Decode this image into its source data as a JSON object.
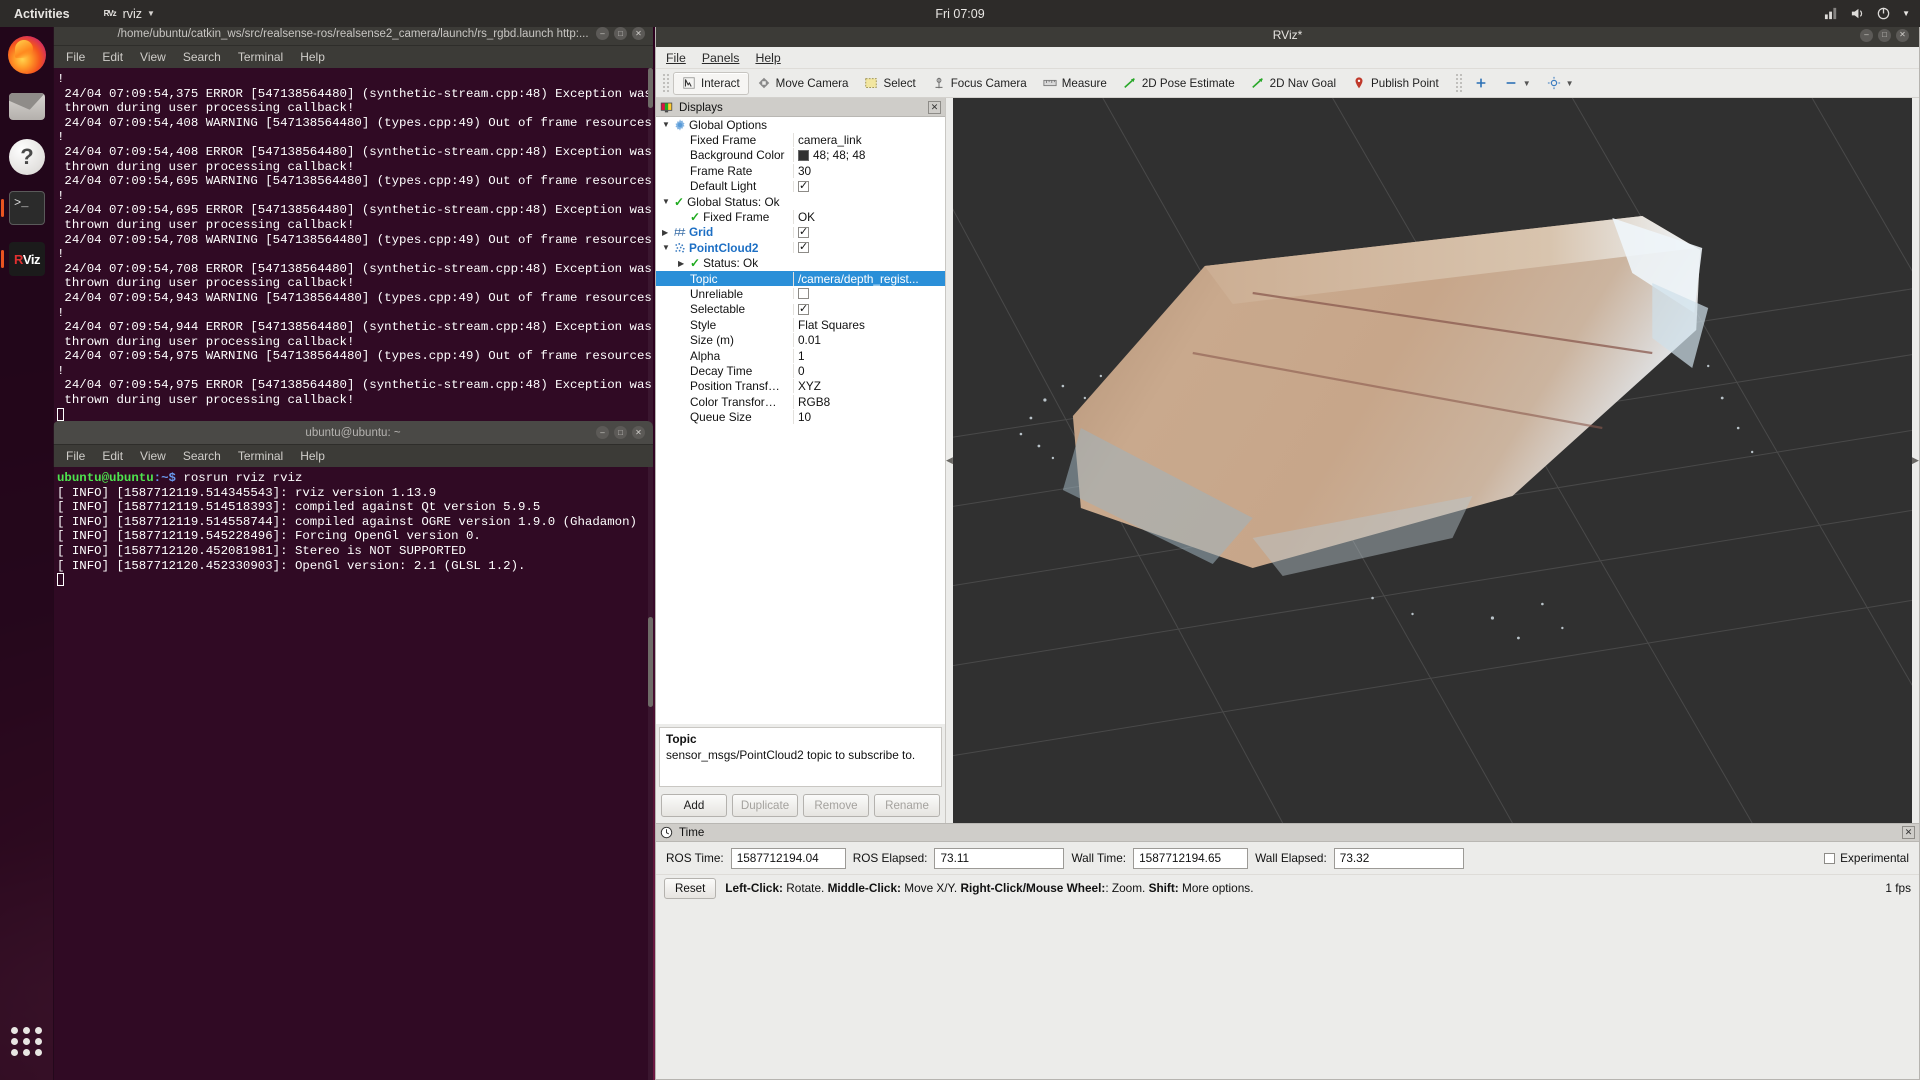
{
  "top_panel": {
    "activities": "Activities",
    "app_name": "rviz",
    "app_logo": "RViz",
    "clock": "Fri 07:09",
    "icons": [
      "network-icon",
      "volume-icon",
      "power-icon",
      "chevron-down-icon"
    ]
  },
  "dock": {
    "items": [
      {
        "name": "firefox-icon",
        "label": "Firefox"
      },
      {
        "name": "thunderbird-icon",
        "label": "Thunderbird"
      },
      {
        "name": "help-icon",
        "label": "Help"
      },
      {
        "name": "terminal-icon",
        "label": "Terminal"
      },
      {
        "name": "rviz-icon",
        "label": "RViz"
      }
    ],
    "show_apps": "show-applications-icon"
  },
  "terminal1": {
    "title": "/home/ubuntu/catkin_ws/src/realsense-ros/realsense2_camera/launch/rs_rgbd.launch http:...",
    "menu": [
      "File",
      "Edit",
      "View",
      "Search",
      "Terminal",
      "Help"
    ],
    "lines": [
      "!",
      " 24/04 07:09:54,375 ERROR [547138564480] (synthetic-stream.cpp:48) Exception was",
      " thrown during user processing callback!",
      " 24/04 07:09:54,408 WARNING [547138564480] (types.cpp:49) Out of frame resources",
      "!",
      " 24/04 07:09:54,408 ERROR [547138564480] (synthetic-stream.cpp:48) Exception was",
      " thrown during user processing callback!",
      " 24/04 07:09:54,695 WARNING [547138564480] (types.cpp:49) Out of frame resources",
      "!",
      " 24/04 07:09:54,695 ERROR [547138564480] (synthetic-stream.cpp:48) Exception was",
      " thrown during user processing callback!",
      " 24/04 07:09:54,708 WARNING [547138564480] (types.cpp:49) Out of frame resources",
      "!",
      " 24/04 07:09:54,708 ERROR [547138564480] (synthetic-stream.cpp:48) Exception was",
      " thrown during user processing callback!",
      " 24/04 07:09:54,943 WARNING [547138564480] (types.cpp:49) Out of frame resources",
      "!",
      " 24/04 07:09:54,944 ERROR [547138564480] (synthetic-stream.cpp:48) Exception was",
      " thrown during user processing callback!",
      " 24/04 07:09:54,975 WARNING [547138564480] (types.cpp:49) Out of frame resources",
      "!",
      " 24/04 07:09:54,975 ERROR [547138564480] (synthetic-stream.cpp:48) Exception was",
      " thrown during user processing callback!"
    ]
  },
  "terminal2": {
    "title": "ubuntu@ubuntu: ~",
    "menu": [
      "File",
      "Edit",
      "View",
      "Search",
      "Terminal",
      "Help"
    ],
    "prompt_user": "ubuntu@ubuntu",
    "prompt_path": ":~$",
    "command": " rosrun rviz rviz",
    "lines": [
      "[ INFO] [1587712119.514345543]: rviz version 1.13.9",
      "[ INFO] [1587712119.514518393]: compiled against Qt version 5.9.5",
      "[ INFO] [1587712119.514558744]: compiled against OGRE version 1.9.0 (Ghadamon)",
      "[ INFO] [1587712119.545228496]: Forcing OpenGl version 0.",
      "[ INFO] [1587712120.452081981]: Stereo is NOT SUPPORTED",
      "[ INFO] [1587712120.452330903]: OpenGl version: 2.1 (GLSL 1.2)."
    ]
  },
  "rviz": {
    "title": "RViz*",
    "menu": [
      "File",
      "Panels",
      "Help"
    ],
    "toolbar": [
      {
        "label": "Interact",
        "icon": "interact-icon",
        "selected": true
      },
      {
        "label": "Move Camera",
        "icon": "move-camera-icon",
        "selected": false
      },
      {
        "label": "Select",
        "icon": "select-icon",
        "selected": false
      },
      {
        "label": "Focus Camera",
        "icon": "focus-camera-icon",
        "selected": false
      },
      {
        "label": "Measure",
        "icon": "measure-icon",
        "selected": false
      },
      {
        "label": "2D Pose Estimate",
        "icon": "pose-estimate-icon",
        "selected": false
      },
      {
        "label": "2D Nav Goal",
        "icon": "nav-goal-icon",
        "selected": false
      },
      {
        "label": "Publish Point",
        "icon": "publish-point-icon",
        "selected": false
      }
    ],
    "toolbar_extra": [
      "plus-icon",
      "minus-icon",
      "settings-icon"
    ],
    "displays": {
      "title": "Displays",
      "rows": [
        {
          "indent": 1,
          "tri": "down",
          "icon": "gear-icon",
          "name": "Global Options",
          "value": "",
          "vtype": "none",
          "bold": false
        },
        {
          "indent": 2,
          "tri": "",
          "icon": "",
          "name": "Fixed Frame",
          "value": "camera_link",
          "vtype": "text",
          "bold": false
        },
        {
          "indent": 2,
          "tri": "",
          "icon": "",
          "name": "Background Color",
          "value": "48; 48; 48",
          "vtype": "color",
          "bold": false
        },
        {
          "indent": 2,
          "tri": "",
          "icon": "",
          "name": "Frame Rate",
          "value": "30",
          "vtype": "text",
          "bold": false
        },
        {
          "indent": 2,
          "tri": "",
          "icon": "",
          "name": "Default Light",
          "value": "",
          "vtype": "check-on",
          "bold": false
        },
        {
          "indent": 1,
          "tri": "down",
          "icon": "check-icon",
          "name": "Global Status: Ok",
          "value": "",
          "vtype": "none",
          "bold": false
        },
        {
          "indent": 2,
          "tri": "",
          "icon": "check-icon",
          "name": "Fixed Frame",
          "value": "OK",
          "vtype": "text",
          "bold": false
        },
        {
          "indent": 1,
          "tri": "right",
          "icon": "grid-icon",
          "name": "Grid",
          "value": "",
          "vtype": "check-on",
          "bold": true
        },
        {
          "indent": 1,
          "tri": "down",
          "icon": "pointcloud-icon",
          "name": "PointCloud2",
          "value": "",
          "vtype": "check-on",
          "bold": true
        },
        {
          "indent": 2,
          "tri": "right",
          "icon": "check-icon",
          "name": "Status: Ok",
          "value": "",
          "vtype": "none",
          "bold": false
        },
        {
          "indent": 2,
          "tri": "",
          "icon": "",
          "name": "Topic",
          "value": "/camera/depth_regist...",
          "vtype": "text",
          "bold": false,
          "selected": true
        },
        {
          "indent": 2,
          "tri": "",
          "icon": "",
          "name": "Unreliable",
          "value": "",
          "vtype": "check-off",
          "bold": false
        },
        {
          "indent": 2,
          "tri": "",
          "icon": "",
          "name": "Selectable",
          "value": "",
          "vtype": "check-on",
          "bold": false
        },
        {
          "indent": 2,
          "tri": "",
          "icon": "",
          "name": "Style",
          "value": "Flat Squares",
          "vtype": "text",
          "bold": false
        },
        {
          "indent": 2,
          "tri": "",
          "icon": "",
          "name": "Size (m)",
          "value": "0.01",
          "vtype": "text",
          "bold": false
        },
        {
          "indent": 2,
          "tri": "",
          "icon": "",
          "name": "Alpha",
          "value": "1",
          "vtype": "text",
          "bold": false
        },
        {
          "indent": 2,
          "tri": "",
          "icon": "",
          "name": "Decay Time",
          "value": "0",
          "vtype": "text",
          "bold": false
        },
        {
          "indent": 2,
          "tri": "",
          "icon": "",
          "name": "Position Transf…",
          "value": "XYZ",
          "vtype": "text",
          "bold": false
        },
        {
          "indent": 2,
          "tri": "",
          "icon": "",
          "name": "Color Transfor…",
          "value": "RGB8",
          "vtype": "text",
          "bold": false
        },
        {
          "indent": 2,
          "tri": "",
          "icon": "",
          "name": "Queue Size",
          "value": "10",
          "vtype": "text",
          "bold": false
        }
      ]
    },
    "help": {
      "title": "Topic",
      "text": "sensor_msgs/PointCloud2 topic to subscribe to."
    },
    "buttons": [
      {
        "label": "Add",
        "enabled": true
      },
      {
        "label": "Duplicate",
        "enabled": false
      },
      {
        "label": "Remove",
        "enabled": false
      },
      {
        "label": "Rename",
        "enabled": false
      }
    ],
    "time": {
      "title": "Time",
      "ros_time_label": "ROS Time:",
      "ros_time_value": "1587712194.04",
      "ros_elapsed_label": "ROS Elapsed:",
      "ros_elapsed_value": "73.11",
      "wall_time_label": "Wall Time:",
      "wall_time_value": "1587712194.65",
      "wall_elapsed_label": "Wall Elapsed:",
      "wall_elapsed_value": "73.32",
      "experimental_label": "Experimental"
    },
    "status": {
      "reset_label": "Reset",
      "hint_1_b": "Left-Click:",
      "hint_1": " Rotate. ",
      "hint_2_b": "Middle-Click:",
      "hint_2": " Move X/Y. ",
      "hint_3_b": "Right-Click/Mouse Wheel:",
      "hint_3": ": Zoom. ",
      "hint_4_b": "Shift:",
      "hint_4": " More options.",
      "fps": "1 fps"
    }
  }
}
